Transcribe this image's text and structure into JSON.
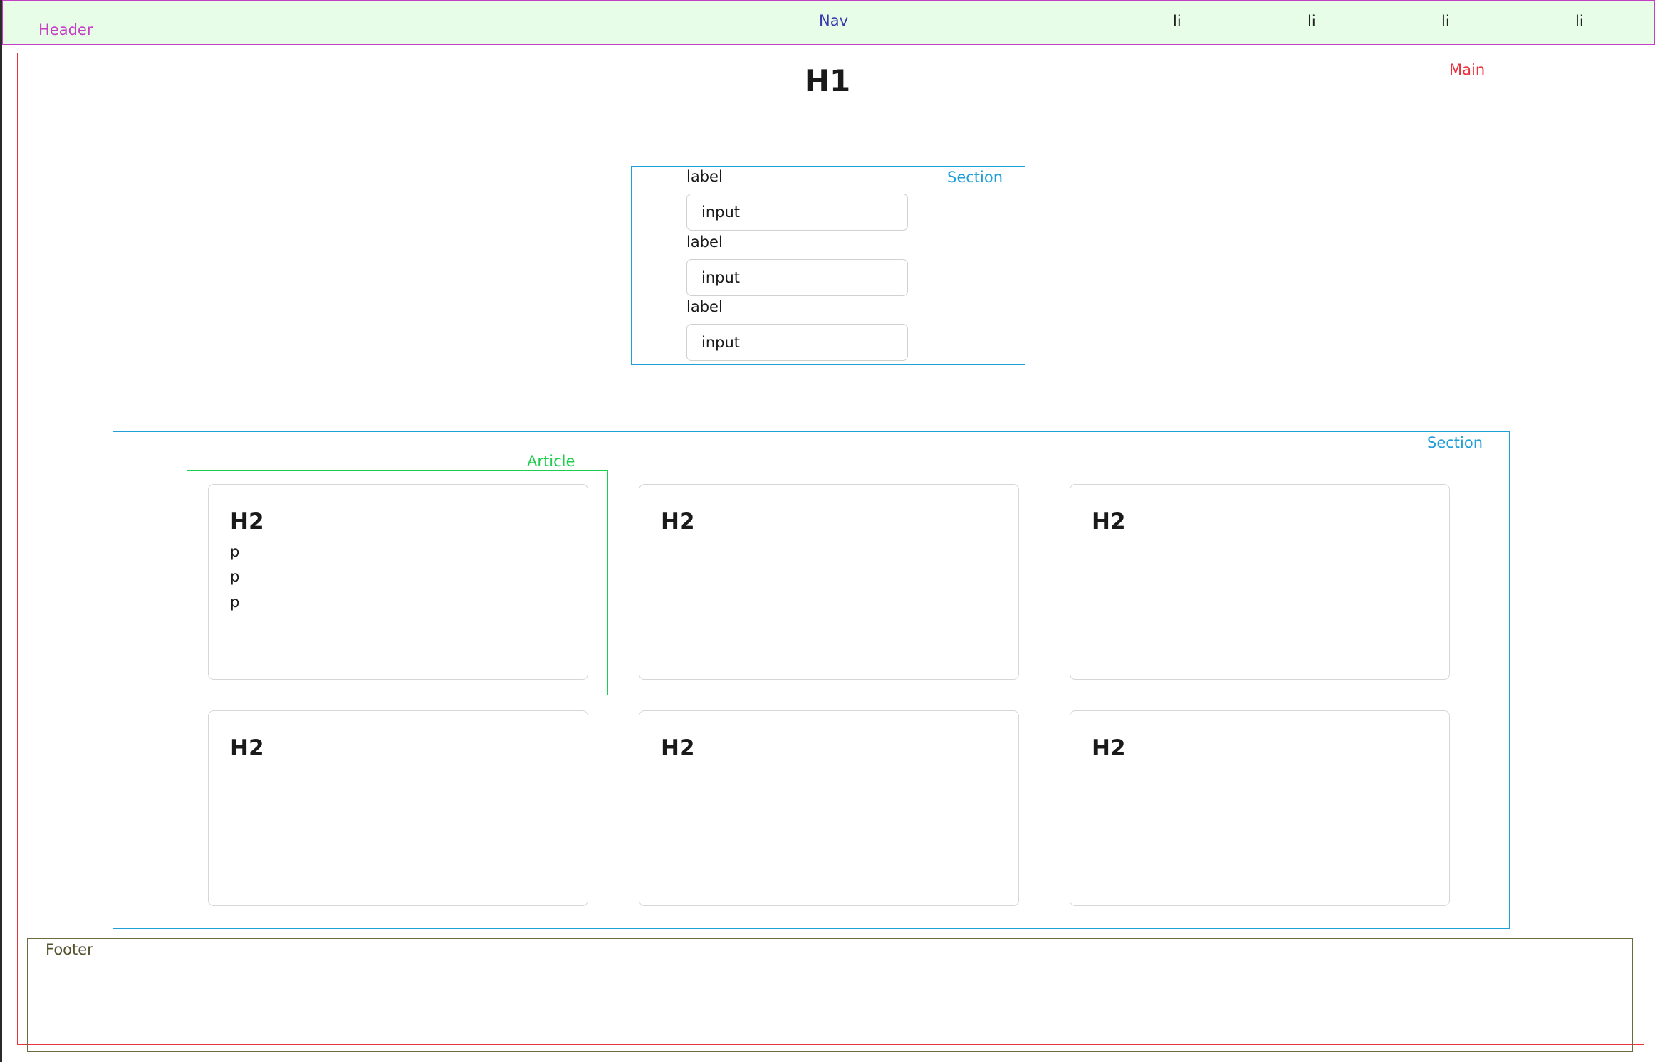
{
  "colors": {
    "header_border": "#c43fc4",
    "header_bg": "#e8fde8",
    "nav_label": "#3a3ab0",
    "main_border": "#e8333e",
    "section_border": "#1f9fd8",
    "article_border": "#1ecc4e",
    "footer_border": "#6e6b40"
  },
  "header": {
    "tag": "Header",
    "nav": {
      "tag": "Nav",
      "items": [
        "li",
        "li",
        "li",
        "li"
      ]
    }
  },
  "main": {
    "tag": "Main",
    "h1": "H1",
    "form_section": {
      "tag": "Section",
      "fields": [
        {
          "label": "label",
          "value": "input"
        },
        {
          "label": "label",
          "value": "input"
        },
        {
          "label": "label",
          "value": "input"
        }
      ]
    },
    "cards_section": {
      "tag": "Section",
      "article_tag": "Article",
      "cards": [
        {
          "heading": "H2",
          "paragraphs": [
            "p",
            "p",
            "p"
          ]
        },
        {
          "heading": "H2"
        },
        {
          "heading": "H2"
        },
        {
          "heading": "H2"
        },
        {
          "heading": "H2"
        },
        {
          "heading": "H2"
        }
      ]
    }
  },
  "footer": {
    "tag": "Footer"
  }
}
